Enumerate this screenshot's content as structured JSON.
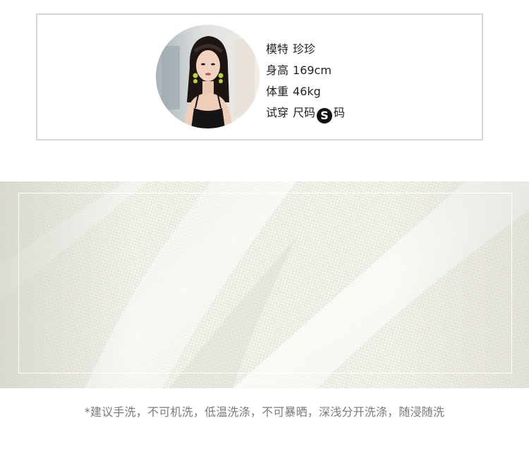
{
  "model": {
    "name_label": "模特",
    "name_value": "珍珍",
    "height_label": "身高",
    "height_value": "169cm",
    "weight_label": "体重",
    "weight_value": "46kg",
    "size_label": "试穿",
    "size_prefix": "尺码",
    "size_value": "S",
    "size_suffix": "码"
  },
  "care": {
    "note": "*建议手洗，不可机洗，低温洗涤，不可暴晒，深浅分开洗涤，随浸随洗"
  },
  "colors": {
    "fabric": "#f4f3ec",
    "badge": "#111111",
    "card_border": "#d6d6d6",
    "note_text": "#7a7a7a"
  }
}
